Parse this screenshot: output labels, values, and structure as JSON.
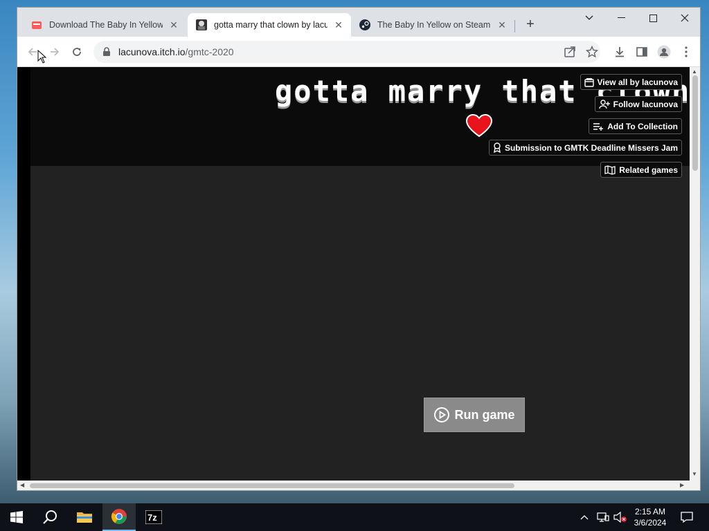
{
  "browser": {
    "tabs": [
      {
        "title": "Download The Baby In Yellow by",
        "favicon": "itch-icon",
        "active": false
      },
      {
        "title": "gotta marry that clown by lacunova",
        "favicon": "game-thumb-icon",
        "active": true
      },
      {
        "title": "The Baby In Yellow on Steam",
        "favicon": "steam-icon",
        "active": false
      }
    ],
    "url_host": "lacunova.itch.io",
    "url_path": "/gmtc-2020"
  },
  "page": {
    "game_title": "gotta marry that clown",
    "buttons": {
      "view_all": "View all by lacunova",
      "follow": "Follow lacunova",
      "add_collection": "Add To Collection",
      "submission": "Submission to GMTK Deadline Missers Jam",
      "related": "Related games"
    },
    "run_game": "Run game"
  },
  "taskbar": {
    "time": "2:15 AM",
    "date": "3/6/2024"
  },
  "colors": {
    "heart": "#e8131b",
    "page_bg": "#222222",
    "header_bg": "#0b0b0b"
  }
}
